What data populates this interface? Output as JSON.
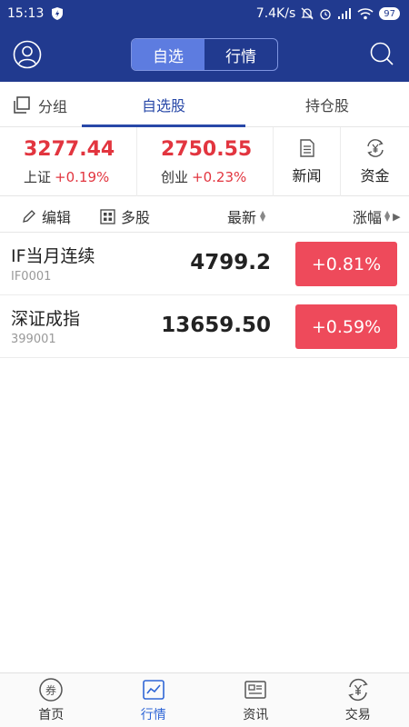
{
  "status_bar": {
    "time": "15:13",
    "net_speed": "7.4K/s",
    "battery": "97"
  },
  "header": {
    "tabs": [
      {
        "label": "自选",
        "active": true
      },
      {
        "label": "行情",
        "active": false
      }
    ]
  },
  "subtabs": {
    "group": "分组",
    "watchlist": "自选股",
    "holdings": "持仓股"
  },
  "indexes": [
    {
      "value": "3277.44",
      "name": "上证",
      "change": "+0.19%"
    },
    {
      "value": "2750.55",
      "name": "创业",
      "change": "+0.23%"
    }
  ],
  "quick": {
    "news": "新闻",
    "fund": "资金"
  },
  "list_header": {
    "edit": "编辑",
    "multi": "多股",
    "latest": "最新",
    "change": "涨幅"
  },
  "rows": [
    {
      "name": "IF当月连续",
      "code": "IF0001",
      "price": "4799.2",
      "change": "+0.81%"
    },
    {
      "name": "深证成指",
      "code": "399001",
      "price": "13659.50",
      "change": "+0.59%"
    }
  ],
  "bottom_nav": [
    {
      "label": "首页",
      "active": false
    },
    {
      "label": "行情",
      "active": true
    },
    {
      "label": "资讯",
      "active": false
    },
    {
      "label": "交易",
      "active": false
    }
  ],
  "colors": {
    "primary": "#213a8f",
    "accent": "#2848a8",
    "up": "#e2353f",
    "up_button": "#ee4a5b",
    "nav_active": "#2f66d6"
  }
}
